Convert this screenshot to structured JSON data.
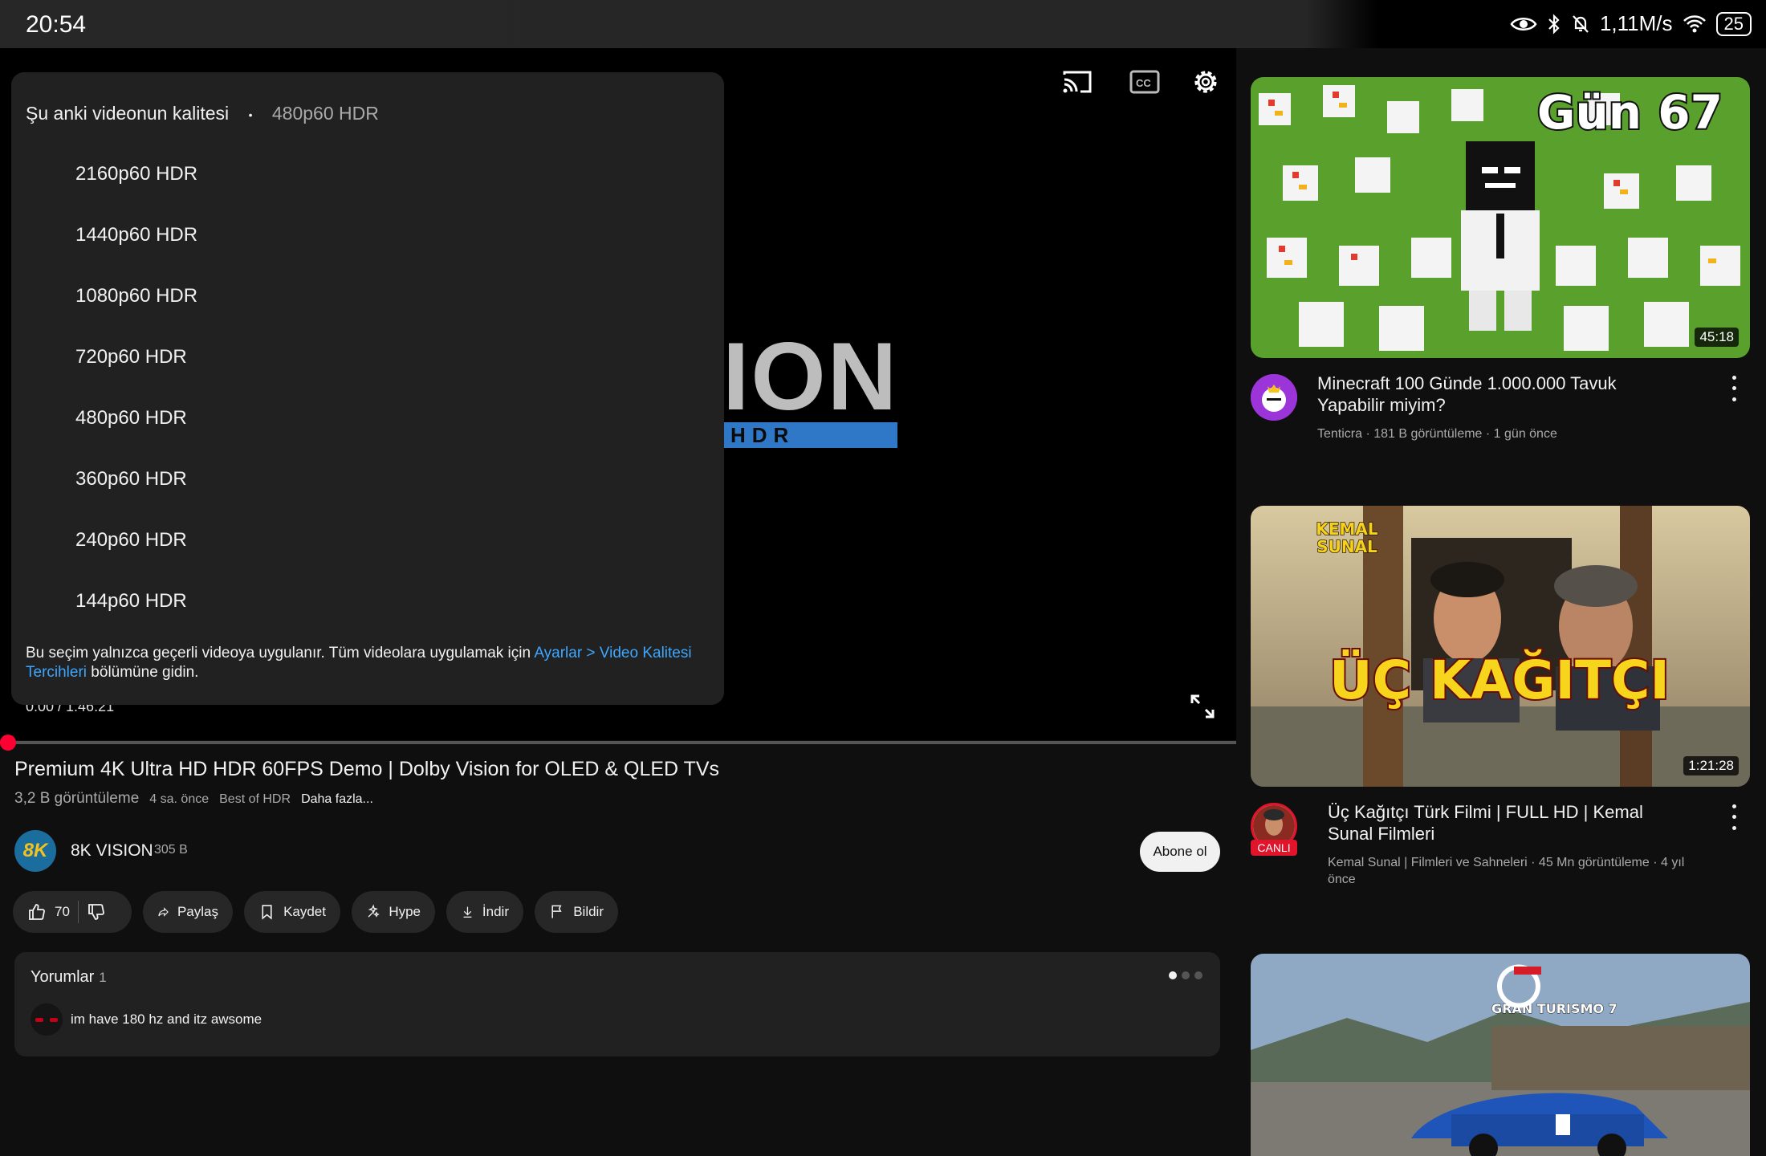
{
  "status": {
    "time": "20:54",
    "speed": "1,11M/s",
    "battery": "25"
  },
  "player": {
    "logo_text": "ION",
    "logo_sub": "HDR",
    "timecode": "0:00 / 1:46:21"
  },
  "quality": {
    "header_label": "Şu anki videonun kalitesi",
    "separator": "•",
    "current": "480p60 HDR",
    "options": [
      "2160p60 HDR",
      "1440p60 HDR",
      "1080p60 HDR",
      "720p60 HDR",
      "480p60 HDR",
      "360p60 HDR",
      "240p60 HDR",
      "144p60 HDR"
    ],
    "note_prefix": "Bu seçim yalnızca geçerli videoya uygulanır. Tüm videolara uygulamak için ",
    "note_link": "Ayarlar > Video Kalitesi Tercihleri",
    "note_suffix": " bölümüne gidin."
  },
  "video": {
    "title": "Premium 4K Ultra HD HDR 60FPS Demo | Dolby Vision for OLED & QLED TVs",
    "views": "3,2 B görüntüleme",
    "age": "4 sa. önce",
    "tag": "Best of HDR",
    "more": "Daha fazla..."
  },
  "channel": {
    "avatar_text": "8K",
    "name": "8K VISION",
    "subs": "305 B",
    "subscribe_label": "Abone ol"
  },
  "actions": {
    "likes": "70",
    "share": "Paylaş",
    "save": "Kaydet",
    "hype": "Hype",
    "download": "İndir",
    "report": "Bildir"
  },
  "comments": {
    "title": "Yorumlar",
    "count": "1",
    "top_comment": "im have 180 hz and itz awsome"
  },
  "recommendations": [
    {
      "thumb_text": "Gün 67",
      "duration": "45:18",
      "title": "Minecraft 100 Günde 1.000.000 Tavuk Yapabilir miyim?",
      "channel": "Tenticra",
      "views": "181 B görüntüleme",
      "age": "1 gün önce"
    },
    {
      "thumb_text": "ÜÇ KAĞITÇI",
      "duration": "1:21:28",
      "title": "Üç Kağıtçı Türk Filmi | FULL HD | Kemal Sunal Filmleri",
      "channel": "Kemal Sunal | Filmleri ve Sahneleri",
      "views": "45 Mn görüntüleme",
      "age": "4 yıl önce",
      "live_badge": "CANLI"
    },
    {
      "thumb_text": "GRAN TURISMO 7"
    }
  ],
  "colors": {
    "accent_red": "#ff0033",
    "link_blue": "#3ea6ff",
    "panel": "#212121"
  }
}
